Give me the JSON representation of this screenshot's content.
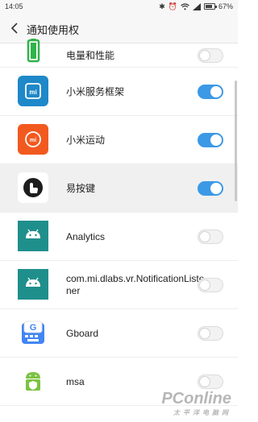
{
  "status_bar": {
    "time": "14:05",
    "battery_text": "67%",
    "icons": [
      "bluetooth-icon",
      "alarm-icon",
      "wifi-icon",
      "signal-icon",
      "battery-icon"
    ]
  },
  "header": {
    "title": "通知使用权",
    "back_icon": "chevron-left-icon"
  },
  "items": [
    {
      "label": "电量和性能",
      "enabled": false,
      "icon": "battery-performance-icon",
      "icon_color": "#2fb34a"
    },
    {
      "label": "小米服务框架",
      "enabled": true,
      "icon": "mi-service-framework-icon",
      "icon_color": "#1e88c8"
    },
    {
      "label": "小米运动",
      "enabled": true,
      "icon": "mi-fit-icon",
      "icon_color": "#f2591f"
    },
    {
      "label": "易按键",
      "enabled": true,
      "icon": "easy-button-icon",
      "icon_color": "#222222"
    },
    {
      "label": "Analytics",
      "enabled": false,
      "icon": "android-icon",
      "icon_color": "#1f8f8c"
    },
    {
      "label": "com.mi.dlabs.vr.NotificationListener",
      "enabled": false,
      "icon": "android-icon",
      "icon_color": "#1f8f8c"
    },
    {
      "label": "Gboard",
      "enabled": false,
      "icon": "gboard-icon",
      "icon_color": "#4285f4"
    },
    {
      "label": "msa",
      "enabled": false,
      "icon": "android-shield-icon",
      "icon_color": "#7cc242"
    }
  ],
  "watermark": {
    "main": "PConline",
    "sub": "太平洋电脑网"
  },
  "colors": {
    "toggle_on": "#3b99e6",
    "highlight_row": "#f0f0f0"
  }
}
